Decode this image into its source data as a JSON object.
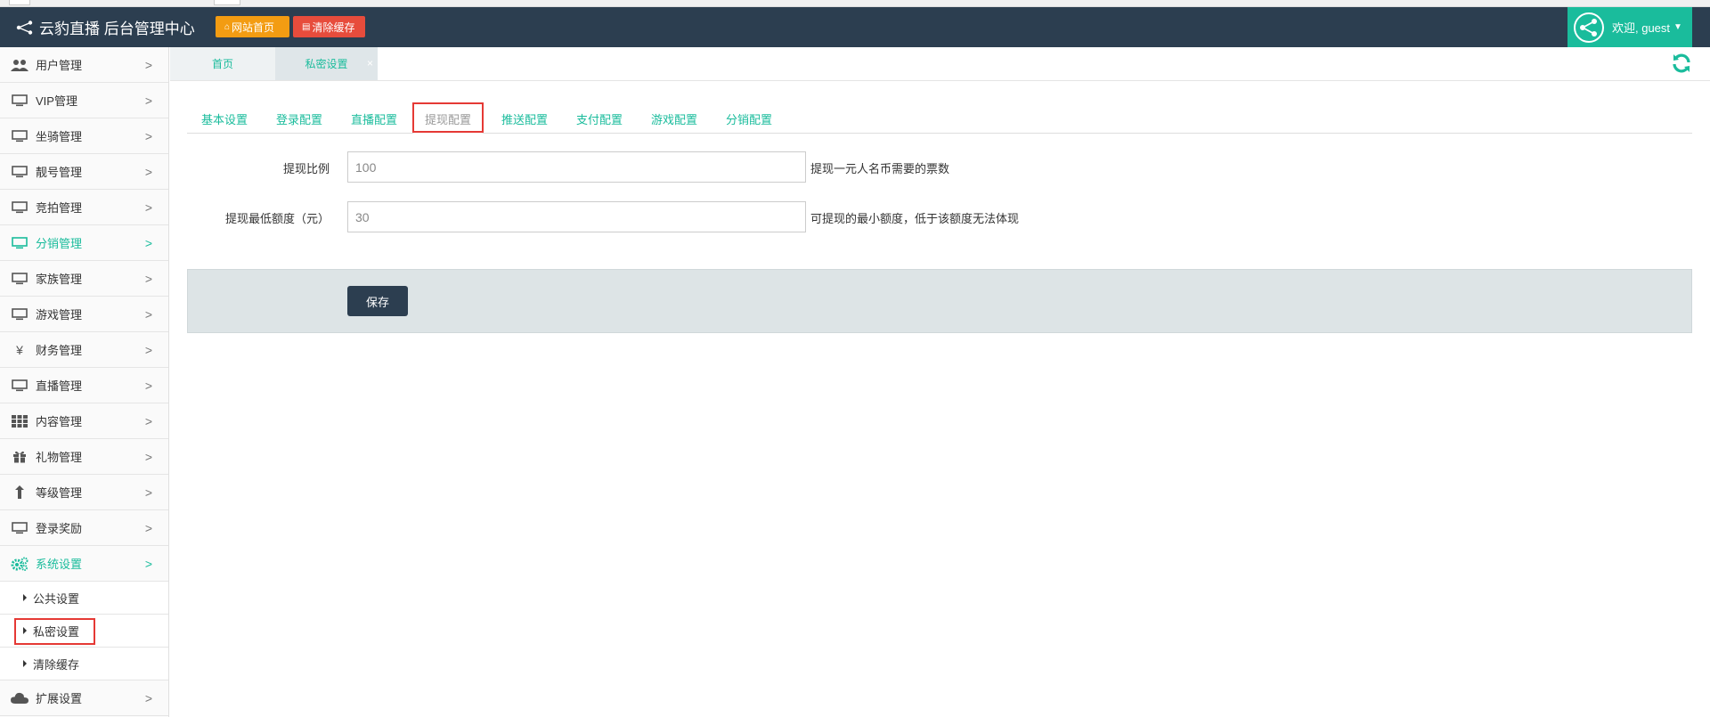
{
  "header": {
    "brand": "云豹直播 后台管理中心",
    "buttons": {
      "site_home": "网站首页",
      "clear_cache": "清除缓存"
    },
    "user": {
      "welcome": "欢迎, guest"
    }
  },
  "sidebar": {
    "items": [
      {
        "label": "用户管理",
        "icon": "users-icon"
      },
      {
        "label": "VIP管理",
        "icon": "desktop-icon"
      },
      {
        "label": "坐骑管理",
        "icon": "desktop-icon"
      },
      {
        "label": "靓号管理",
        "icon": "desktop-icon"
      },
      {
        "label": "竞拍管理",
        "icon": "desktop-icon"
      },
      {
        "label": "分销管理",
        "icon": "desktop-icon",
        "active": true
      },
      {
        "label": "家族管理",
        "icon": "desktop-icon"
      },
      {
        "label": "游戏管理",
        "icon": "desktop-icon"
      },
      {
        "label": "财务管理",
        "icon": "yen-icon"
      },
      {
        "label": "直播管理",
        "icon": "desktop-icon"
      },
      {
        "label": "内容管理",
        "icon": "grid-icon"
      },
      {
        "label": "礼物管理",
        "icon": "gift-icon"
      },
      {
        "label": "等级管理",
        "icon": "level-up-icon"
      },
      {
        "label": "登录奖励",
        "icon": "desktop-icon"
      },
      {
        "label": "系统设置",
        "icon": "cogs-icon",
        "active": true
      }
    ],
    "sub_items": [
      {
        "label": "公共设置"
      },
      {
        "label": "私密设置",
        "selected": true
      },
      {
        "label": "清除缓存"
      }
    ],
    "last_item": {
      "label": "扩展设置",
      "icon": "cloud-icon"
    }
  },
  "page_tabs": {
    "home": "首页",
    "private": "私密设置",
    "close_glyph": "×"
  },
  "config_tabs": [
    "基本设置",
    "登录配置",
    "直播配置",
    "提现配置",
    "推送配置",
    "支付配置",
    "游戏配置",
    "分销配置"
  ],
  "active_config_tab": "提现配置",
  "form": {
    "ratio": {
      "label": "提现比例",
      "value": "100",
      "help": "提现一元人名币需要的票数"
    },
    "min_amount": {
      "label": "提现最低额度（元）",
      "value": "30",
      "help": "可提现的最小额度，低于该额度无法体现"
    },
    "save_label": "保存"
  },
  "colors": {
    "header_bg": "#2c3e50",
    "accent": "#1abc9c",
    "orange": "#f39c12",
    "red": "#e74c3c",
    "highlight_box": "#e53935"
  }
}
